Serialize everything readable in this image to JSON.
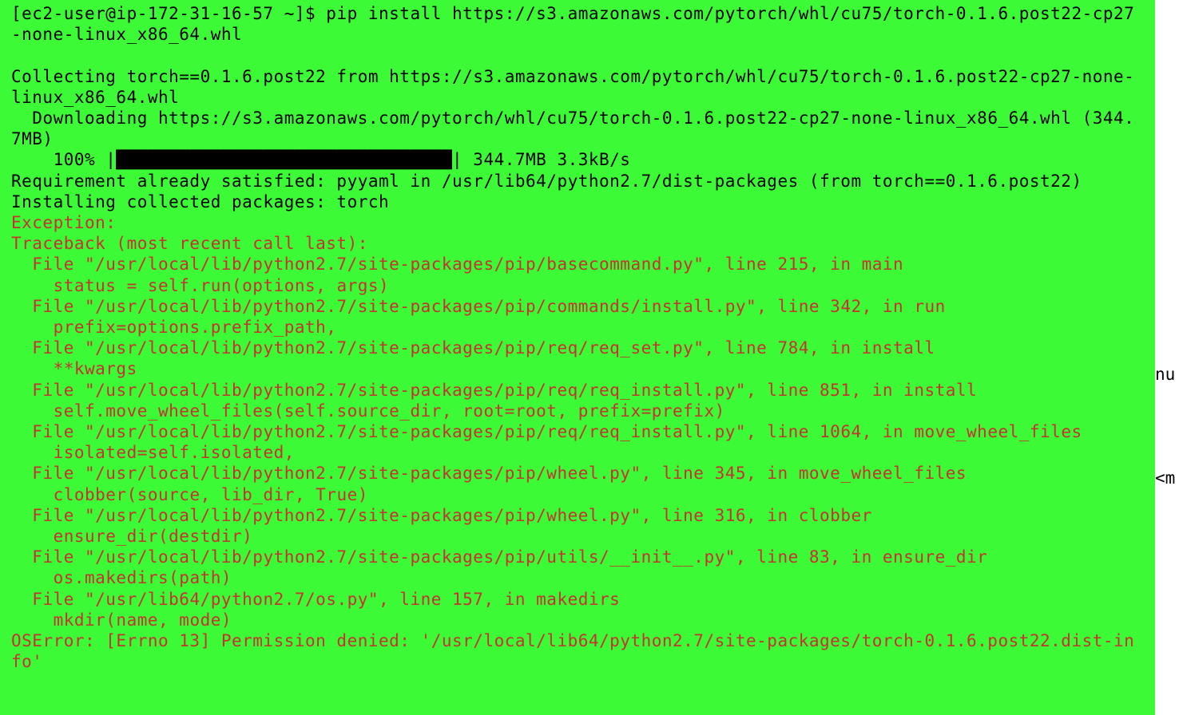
{
  "terminal": {
    "prompt_user_host": "[ec2-user@ip-172-31-16-57 ~]$ ",
    "command": "pip install https://s3.amazonaws.com/pytorch/whl/cu75/torch-0.1.6.post22-cp27-none-linux_x86_64.whl",
    "blank1": "",
    "collecting": "Collecting torch==0.1.6.post22 from https://s3.amazonaws.com/pytorch/whl/cu75/torch-0.1.6.post22-cp27-none-linux_x86_64.whl",
    "downloading": "  Downloading https://s3.amazonaws.com/pytorch/whl/cu75/torch-0.1.6.post22-cp27-none-linux_x86_64.whl (344.7MB)",
    "progress_prefix": "    100% |",
    "progress_bar": "████████████████████████████████",
    "progress_suffix": "| 344.7MB 3.3kB/s",
    "req_satisfied": "Requirement already satisfied: pyyaml in /usr/lib64/python2.7/dist-packages (from torch==0.1.6.post22)",
    "installing": "Installing collected packages: torch",
    "exception": "Exception:",
    "traceback_header": "Traceback (most recent call last):",
    "tb": [
      "  File \"/usr/local/lib/python2.7/site-packages/pip/basecommand.py\", line 215, in main",
      "    status = self.run(options, args)",
      "  File \"/usr/local/lib/python2.7/site-packages/pip/commands/install.py\", line 342, in run",
      "    prefix=options.prefix_path,",
      "  File \"/usr/local/lib/python2.7/site-packages/pip/req/req_set.py\", line 784, in install",
      "    **kwargs",
      "  File \"/usr/local/lib/python2.7/site-packages/pip/req/req_install.py\", line 851, in install",
      "    self.move_wheel_files(self.source_dir, root=root, prefix=prefix)",
      "  File \"/usr/local/lib/python2.7/site-packages/pip/req/req_install.py\", line 1064, in move_wheel_files",
      "    isolated=self.isolated,",
      "  File \"/usr/local/lib/python2.7/site-packages/pip/wheel.py\", line 345, in move_wheel_files",
      "    clobber(source, lib_dir, True)",
      "  File \"/usr/local/lib/python2.7/site-packages/pip/wheel.py\", line 316, in clobber",
      "    ensure_dir(destdir)",
      "  File \"/usr/local/lib/python2.7/site-packages/pip/utils/__init__.py\", line 83, in ensure_dir",
      "    os.makedirs(path)",
      "  File \"/usr/lib64/python2.7/os.py\", line 157, in makedirs",
      "    mkdir(name, mode)"
    ],
    "oserror": "OSError: [Errno 13] Permission denied: '/usr/local/lib64/python2.7/site-packages/torch-0.1.6.post22.dist-info'"
  },
  "side": {
    "fragment1": "nu",
    "fragment2": "<m"
  }
}
